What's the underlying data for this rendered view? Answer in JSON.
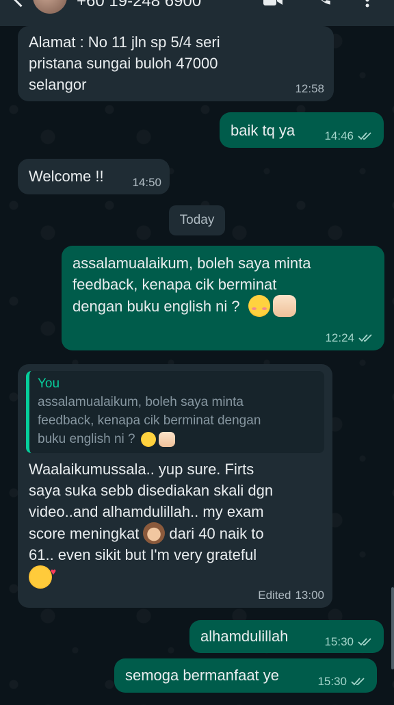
{
  "header": {
    "title": "+60 19-248 6900",
    "icons": [
      "back-arrow-icon",
      "avatar",
      "video-call-icon",
      "voice-call-icon",
      "more-options-icon"
    ]
  },
  "colors": {
    "background": "#0b141a",
    "incoming_bubble": "#1f2c34",
    "outgoing_bubble": "#005c4b",
    "quote_accent": "#06cf9c",
    "read_ticks": "#a5d6cc"
  },
  "messages": [
    {
      "direction": "in",
      "lines": [
        "Alamat : No 11 jln sp 5/4 seri",
        "pristana sungai buloh 47000",
        "selangor"
      ],
      "time": "12:58"
    },
    {
      "direction": "out",
      "text": "baik tq ya",
      "time": "14:46",
      "status": "read"
    },
    {
      "direction": "in",
      "text": "Welcome !!",
      "time": "14:50"
    },
    {
      "direction": "out",
      "lines": [
        "assalamualaikum, boleh saya minta",
        "feedback, kenapa cik berminat",
        "dengan buku english ni ?"
      ],
      "emojis": [
        "relieved-face-icon",
        "raised-hands-icon"
      ],
      "time": "12:24",
      "status": "read"
    },
    {
      "direction": "in",
      "quote": {
        "author": "You",
        "lines": [
          "assalamualaikum, boleh saya minta",
          "feedback, kenapa cik berminat dengan",
          "buku english ni ?"
        ],
        "emojis": [
          "relieved-face-icon",
          "raised-hands-icon"
        ]
      },
      "lines": [
        "Waalaikumussala.. yup sure. Firts",
        "saya suka sebb disediakan skali dgn",
        "video..and alhamdulillah.. my exam",
        "score meningkat",
        "dari  40 naik to",
        "61.. even sikit but I'm very grateful"
      ],
      "emojis": [
        "see-no-evil-monkey-icon",
        "smiling-face-with-hearts-icon"
      ],
      "edited_label": "Edited",
      "time": "13:00"
    },
    {
      "direction": "out",
      "text": "alhamdulillah",
      "time": "15:30",
      "status": "read"
    },
    {
      "direction": "out",
      "text": "semoga bermanfaat ye",
      "time": "15:30",
      "status": "read"
    }
  ],
  "date_divider": "Today"
}
